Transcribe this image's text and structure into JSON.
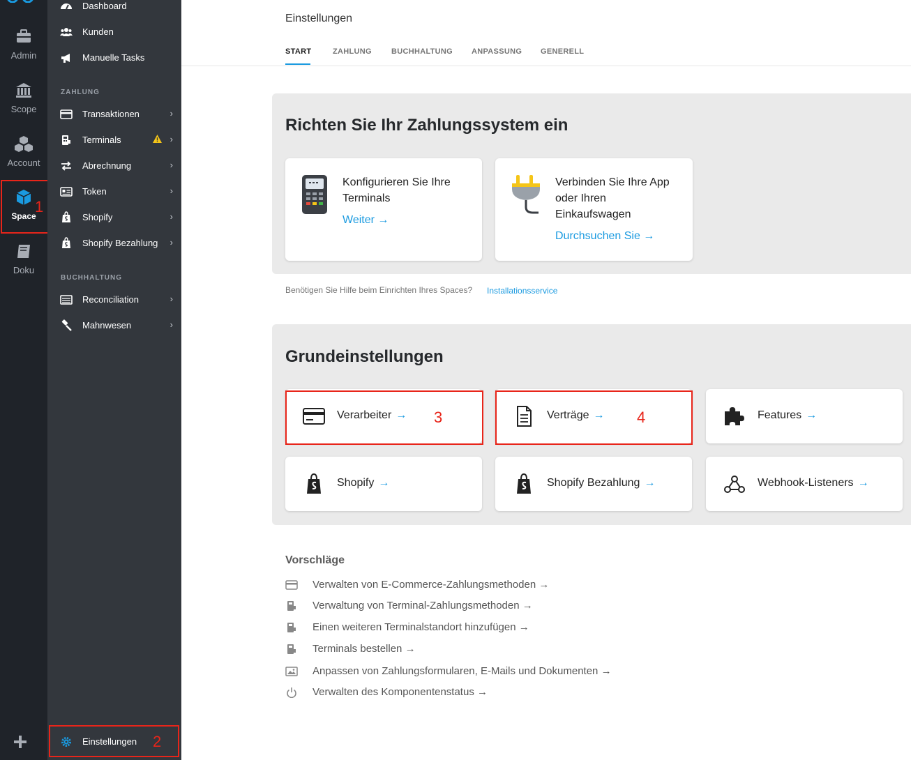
{
  "rail": {
    "items": [
      {
        "label": "Admin",
        "icon": "briefcase-icon"
      },
      {
        "label": "Scope",
        "icon": "bank-icon"
      },
      {
        "label": "Account",
        "icon": "boxes-icon"
      },
      {
        "label": "Space",
        "icon": "cube-icon",
        "active": true
      },
      {
        "label": "Doku",
        "icon": "book-icon"
      }
    ],
    "add_icon": "plus-icon"
  },
  "annotations": {
    "n1": "1",
    "n2": "2",
    "n3": "3",
    "n4": "4"
  },
  "nav": {
    "top_items": [
      {
        "label": "Dashboard",
        "icon": "dashboard-icon"
      },
      {
        "label": "Kunden",
        "icon": "users-icon"
      },
      {
        "label": "Manuelle Tasks",
        "icon": "megaphone-icon"
      }
    ],
    "sections": [
      {
        "title": "ZAHLUNG",
        "items": [
          {
            "label": "Transaktionen",
            "icon": "credit-card-icon"
          },
          {
            "label": "Terminals",
            "icon": "terminal-icon",
            "warning": true
          },
          {
            "label": "Abrechnung",
            "icon": "exchange-icon"
          },
          {
            "label": "Token",
            "icon": "id-card-icon"
          },
          {
            "label": "Shopify",
            "icon": "shopify-icon"
          },
          {
            "label": "Shopify Bezahlung",
            "icon": "shopify-icon"
          }
        ]
      },
      {
        "title": "BUCHHALTUNG",
        "items": [
          {
            "label": "Reconciliation",
            "icon": "ledger-icon"
          },
          {
            "label": "Mahnwesen",
            "icon": "gavel-icon"
          }
        ]
      }
    ],
    "settings": {
      "label": "Einstellungen",
      "icon": "gear-icon"
    }
  },
  "header": {
    "title": "Einstellungen",
    "tabs": [
      "START",
      "ZAHLUNG",
      "BUCHHALTUNG",
      "ANPASSUNG",
      "GENERELL"
    ],
    "active_tab": "START"
  },
  "setup": {
    "title": "Richten Sie Ihr Zahlungssystem ein",
    "cards": [
      {
        "text_lines": [
          "Konfigurieren Sie Ihre",
          "Terminals"
        ],
        "link": "Weiter",
        "icon": "card-terminal-icon"
      },
      {
        "text_lines": [
          "Verbinden Sie Ihre App",
          "oder Ihren",
          "Einkaufswagen"
        ],
        "link": "Durchsuchen Sie",
        "icon": "plug-icon"
      }
    ],
    "help_text": "Benötigen Sie Hilfe beim Einrichten Ihres Spaces?",
    "help_link": "Installationsservice"
  },
  "basics": {
    "title": "Grundeinstellungen",
    "tiles": [
      {
        "label": "Verarbeiter",
        "icon": "credit-card-icon"
      },
      {
        "label": "Verträge",
        "icon": "document-icon"
      },
      {
        "label": "Features",
        "icon": "puzzle-icon"
      },
      {
        "label": "Shopify",
        "icon": "shopify-icon"
      },
      {
        "label": "Shopify Bezahlung",
        "icon": "shopify-icon"
      },
      {
        "label": "Webhook-Listeners",
        "icon": "webhook-icon"
      }
    ]
  },
  "suggestions": {
    "title": "Vorschläge",
    "items": [
      {
        "label": "Verwalten von E-Commerce-Zahlungsmethoden",
        "icon": "credit-card-icon"
      },
      {
        "label": "Verwaltung von Terminal-Zahlungsmethoden",
        "icon": "terminal-icon"
      },
      {
        "label": "Einen weiteren Terminalstandort hinzufügen",
        "icon": "terminal-icon"
      },
      {
        "label": "Terminals bestellen",
        "icon": "terminal-icon"
      },
      {
        "label": "Anpassen von Zahlungsformularen, E-Mails und Dokumenten",
        "icon": "image-icon"
      },
      {
        "label": "Verwalten des Komponentenstatus",
        "icon": "power-icon"
      }
    ]
  },
  "colors": {
    "accent": "#1a9ae0",
    "annotation": "#e8251a",
    "rail_bg": "#1f2329",
    "nav_bg": "#33373d",
    "panel_bg": "#eaeaea"
  }
}
